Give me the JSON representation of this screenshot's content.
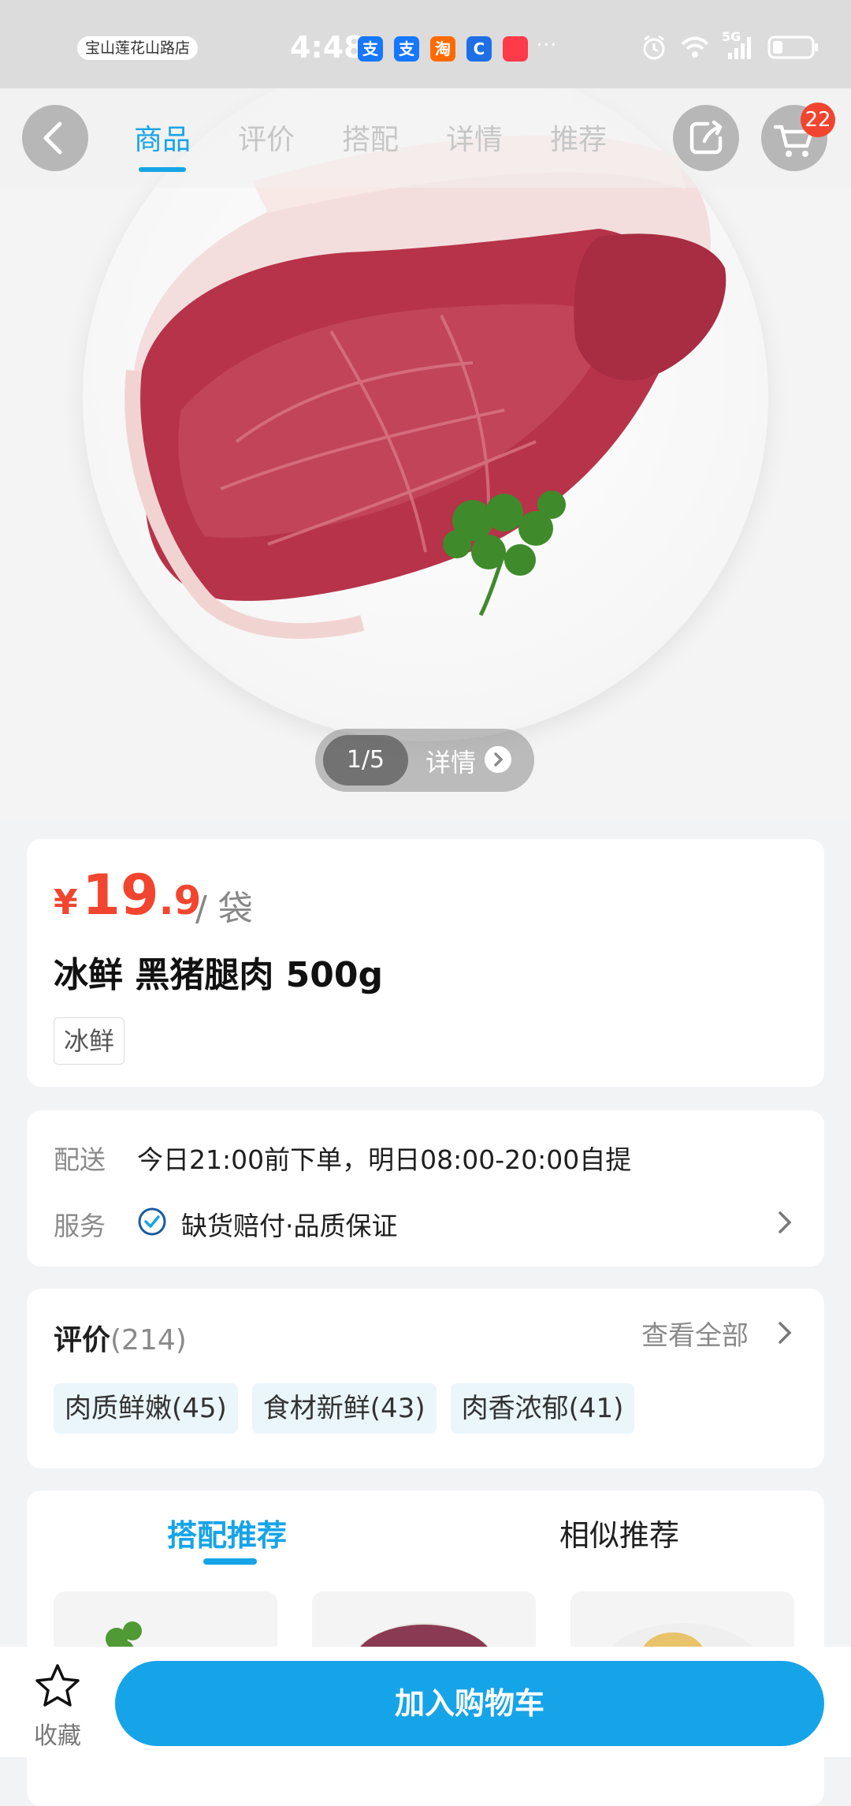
{
  "status_bar": {
    "store_chip": "宝山莲花山路店",
    "time": "4:48",
    "apps": [
      {
        "icon": "alipay-icon",
        "glyph": "支",
        "color": "#1677ff"
      },
      {
        "icon": "alipay-icon",
        "glyph": "支",
        "color": "#1677ff"
      },
      {
        "icon": "taobao-icon",
        "glyph": "淘",
        "color": "#ff6a00"
      },
      {
        "icon": "app-icon",
        "glyph": "C",
        "color": "#1e6fe6"
      },
      {
        "icon": "huawei-icon",
        "glyph": "",
        "color": "#ff3b4a"
      }
    ],
    "more": "···",
    "network": "5G"
  },
  "nav": {
    "tabs": [
      "商品",
      "评价",
      "搭配",
      "详情",
      "推荐"
    ],
    "active_tab": 0,
    "cart_count": "22"
  },
  "gallery": {
    "page": "1/5",
    "detail_label": "详情"
  },
  "product": {
    "currency": "¥",
    "price_int": "19",
    "price_dec": ".9",
    "unit": "/ 袋",
    "title": "冰鲜 黑猪腿肉 500g",
    "tag": "冰鲜"
  },
  "delivery": {
    "label": "配送",
    "value": "今日21:00前下单，明日08:00-20:00自提",
    "service_label": "服务",
    "service_value": "缺货赔付·品质保证"
  },
  "reviews": {
    "title": "评价",
    "count": "(214)",
    "see_all": "查看全部",
    "tags": [
      "肉质鲜嫩(45)",
      "食材新鲜(43)",
      "肉香浓郁(41)"
    ]
  },
  "recommend": {
    "tabs": [
      "搭配推荐",
      "相似推荐"
    ],
    "active_tab": 0
  },
  "bottom": {
    "favorite_label": "收藏",
    "add_to_cart": "加入购物车"
  },
  "colors": {
    "accent": "#16a4e8",
    "price": "#f2452f",
    "badge": "#f2452f"
  }
}
